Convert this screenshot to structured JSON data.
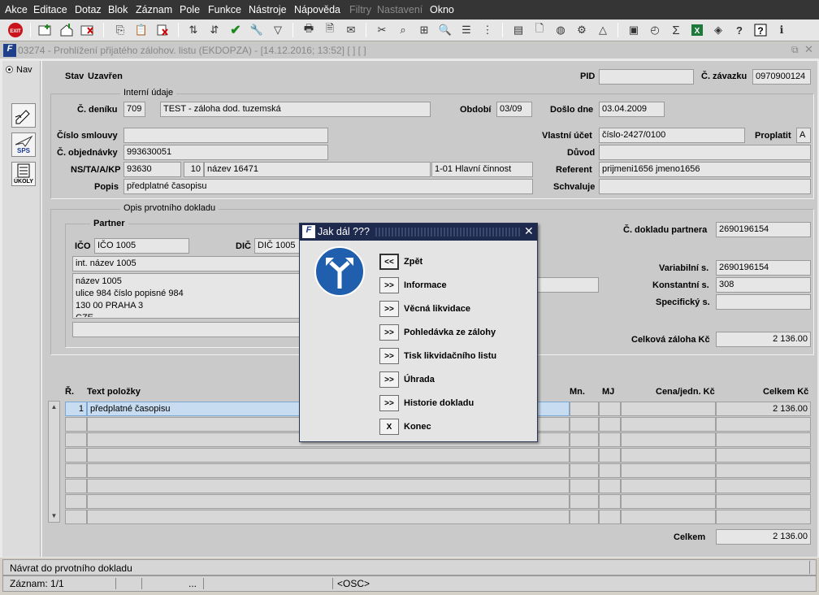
{
  "menu": [
    "Akce",
    "Editace",
    "Dotaz",
    "Blok",
    "Záznam",
    "Pole",
    "Funkce",
    "Nástroje",
    "Nápověda",
    "Filtry",
    "Nastavení",
    "Okno"
  ],
  "menu_disabled": [
    "Filtry",
    "Nastavení"
  ],
  "window": {
    "title": "03274 - Prohlížení přijatého zálohov. listu (EKDOPZA) - [14.12.2016; 13:52]  [ ]  [ ]"
  },
  "left": {
    "nav_label": "Nav",
    "sps": "SPS",
    "ukoly": "ÚKOLY"
  },
  "header": {
    "stav_label": "Stav",
    "stav_value": "Uzavřen",
    "pid_label": "PID",
    "pid_value": "",
    "zavazek_label": "Č. závazku",
    "zavazek_value": "0970900124"
  },
  "interni": {
    "title": "Interní údaje",
    "denik_label": "Č. deníku",
    "denik_code": "709",
    "denik_text": "TEST - záloha dod. tuzemská",
    "obdobi_label": "Období",
    "obdobi_value": "03/09",
    "doslo_label": "Došlo dne",
    "doslo_value": "03.04.2009",
    "smlouva_label": "Číslo smlouvy",
    "smlouva_value": "",
    "objednavka_label": "Č. objednávky",
    "objednavka_value": "993630051",
    "ns_label": "NS/TA/A/KP",
    "ns_value": "93630",
    "ta_value": "10",
    "a_value": "název 16471",
    "kp_value": "1-01 Hlavní činnost",
    "popis_label": "Popis",
    "popis_value": "předplatné časopisu",
    "vlastni_ucet_label": "Vlastní účet",
    "vlastni_ucet_value": "číslo-2427/0100",
    "proplatit_label": "Proplatit",
    "proplatit_value": "A",
    "duvod_label": "Důvod",
    "duvod_value": "",
    "referent_label": "Referent",
    "referent_value": "prijmeni1656 jmeno1656",
    "schvaluje_label": "Schvaluje",
    "schvaluje_value": ""
  },
  "opis": {
    "title": "Opis prvotního dokladu",
    "partner_title": "Partner",
    "ico_label": "IČO",
    "ico_value": "IČO 1005",
    "dic_label": "DIČ",
    "dic_value": "DIČ 1005",
    "int_nazev": "int. název 1005",
    "address": [
      "název 1005",
      "ulice 984 číslo popisné 984",
      "130 00 PRAHA 3",
      "CZE"
    ],
    "doklad_partnera_label": "Č. dokladu partnera",
    "doklad_partnera_value": "2690196154",
    "variabilni_label": "Variabilní s.",
    "variabilni_value": "2690196154",
    "konstantni_label": "Konstantní s.",
    "konstantni_value": "308",
    "specificky_label": "Specifický s.",
    "specificky_value": "",
    "celkova_zaloha_label": "Celková záloha Kč",
    "celkova_zaloha_value": "2 136.00"
  },
  "items": {
    "col_r": "Ř.",
    "col_text": "Text položky",
    "col_mn": "Mn.",
    "col_mj": "MJ",
    "col_cena": "Cena/jedn. Kč",
    "col_celkem": "Celkem Kč",
    "rows": [
      {
        "r": "1",
        "text": "předplatné časopisu",
        "celkem": "2 136.00"
      }
    ],
    "total_label": "Celkem",
    "total_value": "2 136.00"
  },
  "dialog": {
    "title": "Jak dál ???",
    "buttons": [
      {
        "btn": "<<",
        "label": "Zpět"
      },
      {
        "btn": ">>",
        "label": "Informace"
      },
      {
        "btn": ">>",
        "label": "Věcná likvidace"
      },
      {
        "btn": ">>",
        "label": "Pohledávka ze zálohy"
      },
      {
        "btn": ">>",
        "label": "Tisk likvidačního listu"
      },
      {
        "btn": ">>",
        "label": "Úhrada"
      },
      {
        "btn": ">>",
        "label": "Historie dokladu"
      },
      {
        "btn": "X",
        "label": "Konec"
      }
    ]
  },
  "status": {
    "message": "Návrat do prvotního dokladu",
    "record": "Záznam: 1/1",
    "dots": "...",
    "mode": "<OSC>"
  },
  "colors": {
    "menubar": "#353535",
    "dialog_title": "#1e2a4d",
    "selected_row": "#c7dcf0",
    "sign_blue": "#1f5fae"
  }
}
